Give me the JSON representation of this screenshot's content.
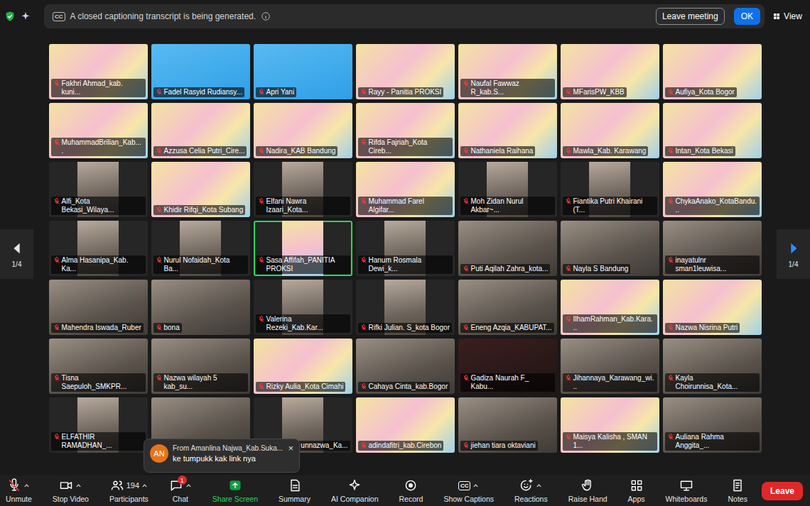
{
  "caption_banner": {
    "icon_text": "CC",
    "text": "A closed captioning transcript is being generated.",
    "buttons": [
      {
        "label": "Leave meeting",
        "primary": false
      },
      {
        "label": "OK",
        "primary": true
      }
    ]
  },
  "view": {
    "label": "View"
  },
  "pager": {
    "label": "1/4"
  },
  "gallery": {
    "tiles": [
      {
        "name": "Fakhri Ahmad_kab. kuni...",
        "kind": "banner",
        "muted": true,
        "speaking": false,
        "covered": false
      },
      {
        "name": "Fadel Rasyid Rudiansy...",
        "kind": "blue",
        "muted": true,
        "speaking": false,
        "covered": false
      },
      {
        "name": "Apri Yani",
        "kind": "blue",
        "muted": true,
        "speaking": false,
        "covered": false
      },
      {
        "name": "Rayy - Panitia PROKSI",
        "kind": "banner",
        "muted": true,
        "speaking": false,
        "covered": false
      },
      {
        "name": "Naufal Fawwaz R_kab.S...",
        "kind": "banner",
        "muted": true,
        "speaking": false,
        "covered": false
      },
      {
        "name": "MFarisPW_KBB",
        "kind": "banner",
        "muted": true,
        "speaking": false,
        "covered": false
      },
      {
        "name": "Aufiya_Kota Bogor",
        "kind": "banner",
        "muted": true,
        "speaking": false,
        "covered": false
      },
      {
        "name": "MuhammadBrilian_Kab....",
        "kind": "banner",
        "muted": true,
        "speaking": false,
        "covered": false
      },
      {
        "name": "Azzusa Celia Putri_Cire...",
        "kind": "banner",
        "muted": true,
        "speaking": false,
        "covered": false
      },
      {
        "name": "Nadira_KAB Bandung",
        "kind": "banner",
        "muted": true,
        "speaking": false,
        "covered": false
      },
      {
        "name": "Rifda Fajriah_Kota Cireb...",
        "kind": "banner",
        "muted": true,
        "speaking": false,
        "covered": false
      },
      {
        "name": "Nathaniela Raihana",
        "kind": "banner",
        "muted": true,
        "speaking": false,
        "covered": false
      },
      {
        "name": "Mawla_Kab. Karawang",
        "kind": "banner",
        "muted": true,
        "speaking": false,
        "covered": false
      },
      {
        "name": "Intan_Kota Bekasi",
        "kind": "banner",
        "muted": true,
        "speaking": false,
        "covered": false
      },
      {
        "name": "Alfi_Kota Bekasi_Wilaya...",
        "kind": "phone",
        "muted": true,
        "speaking": false,
        "covered": false
      },
      {
        "name": "Khidir Rifqi_Kota Subang",
        "kind": "banner",
        "muted": true,
        "speaking": false,
        "covered": false
      },
      {
        "name": "Elfani Nawra Izaari_Kota...",
        "kind": "phone",
        "muted": true,
        "speaking": false,
        "covered": false
      },
      {
        "name": "Muhammad Farel Algifar...",
        "kind": "banner",
        "muted": true,
        "speaking": false,
        "covered": false
      },
      {
        "name": "Moh Zidan Nurul Akbar~...",
        "kind": "phone",
        "muted": true,
        "speaking": false,
        "covered": false
      },
      {
        "name": "Fiantika Putri Khairani (T...",
        "kind": "phone",
        "muted": true,
        "speaking": false,
        "covered": false
      },
      {
        "name": "ChykaAnako_KotaBandu...",
        "kind": "banner",
        "muted": true,
        "speaking": false,
        "covered": false
      },
      {
        "name": "Alma Hasanipa_Kab. Ka...",
        "kind": "phone",
        "muted": true,
        "speaking": false,
        "covered": false
      },
      {
        "name": "Nurul Nofaidah_Kota Ba...",
        "kind": "phone",
        "muted": true,
        "speaking": false,
        "covered": false
      },
      {
        "name": "Sasa Affifah_PANITIA PROKSI",
        "kind": "phone",
        "muted": true,
        "speaking": true,
        "covered": false
      },
      {
        "name": "Hanum Rosmala Dewi_k...",
        "kind": "phone",
        "muted": true,
        "speaking": false,
        "covered": false
      },
      {
        "name": "Puti Aqilah Zahra_kota...",
        "kind": "camera",
        "muted": true,
        "speaking": false,
        "covered": false
      },
      {
        "name": "Nayla S Bandung",
        "kind": "camera",
        "muted": true,
        "speaking": false,
        "covered": false
      },
      {
        "name": "inayatulnr sman1leuwisa...",
        "kind": "camera",
        "muted": true,
        "speaking": false,
        "covered": false
      },
      {
        "name": "Mahendra Iswada_Ruber",
        "kind": "camera",
        "muted": true,
        "speaking": false,
        "covered": false
      },
      {
        "name": "bona",
        "kind": "camera",
        "muted": true,
        "speaking": false,
        "covered": false
      },
      {
        "name": "Valerina Rezeki_Kab.Kar...",
        "kind": "phone",
        "muted": true,
        "speaking": false,
        "covered": false
      },
      {
        "name": "Rifki Julian. S_kota Bogor",
        "kind": "phone",
        "muted": true,
        "speaking": false,
        "covered": false
      },
      {
        "name": "Eneng Azqia_KABUPAT...",
        "kind": "camera",
        "muted": true,
        "speaking": false,
        "covered": false
      },
      {
        "name": "IlhamRahman_Kab.Kara...",
        "kind": "banner",
        "muted": true,
        "speaking": false,
        "covered": false
      },
      {
        "name": "Nazwa Nisrina Putri",
        "kind": "banner",
        "muted": true,
        "speaking": false,
        "covered": false
      },
      {
        "name": "Tisna Saepuloh_SMKPR...",
        "kind": "camera",
        "muted": true,
        "speaking": false,
        "covered": false
      },
      {
        "name": "Nazwa wilayah 5 kab_su...",
        "kind": "camera",
        "muted": true,
        "speaking": false,
        "covered": false
      },
      {
        "name": "Rizky Aulia_Kota Cimahi",
        "kind": "banner",
        "muted": true,
        "speaking": false,
        "covered": false
      },
      {
        "name": "Cahaya Cinta_kab.Bogor",
        "kind": "camera",
        "muted": true,
        "speaking": false,
        "covered": false
      },
      {
        "name": "Gadiza Naurah F_ Kabu...",
        "kind": "dark",
        "muted": true,
        "speaking": false,
        "covered": false
      },
      {
        "name": "Jihannaya_Karawang_wi...",
        "kind": "camera",
        "muted": true,
        "speaking": false,
        "covered": false
      },
      {
        "name": "Kayla Choirunnisa_Kota...",
        "kind": "camera",
        "muted": true,
        "speaking": false,
        "covered": false
      },
      {
        "name": "ELFATHIR RAMADHAN_...",
        "kind": "phone",
        "muted": true,
        "speaking": false,
        "covered": false
      },
      {
        "kind": "camera",
        "muted": true,
        "speaking": false,
        "covered": true
      },
      {
        "name": "unnazwa_Ka...",
        "kind": "phone",
        "muted": true,
        "speaking": false,
        "covered": true
      },
      {
        "name": "adindafitri_kab.Cirebon",
        "kind": "banner",
        "muted": true,
        "speaking": false,
        "covered": false
      },
      {
        "name": "jiehan tiara oktaviani",
        "kind": "camera",
        "muted": true,
        "speaking": false,
        "covered": false
      },
      {
        "name": "Maisya Kalisha , SMAN 1...",
        "kind": "banner",
        "muted": true,
        "speaking": false,
        "covered": false
      },
      {
        "name": "Auliana Rahma Anggita_...",
        "kind": "camera",
        "muted": true,
        "speaking": false,
        "covered": false
      }
    ]
  },
  "chat_toast": {
    "avatar": "AN",
    "from": "From Amanlina Najwa_Kab.Suka...",
    "message": "ke tumpukk kak link nya",
    "close": "×"
  },
  "toolbar": {
    "items": [
      {
        "label": "Unmute",
        "menu": true,
        "off": true,
        "active": false
      },
      {
        "label": "Stop Video",
        "menu": true,
        "off": false,
        "active": false
      },
      {
        "label": "Participants",
        "menu": true,
        "off": false,
        "active": false,
        "count": "194"
      },
      {
        "label": "Chat",
        "menu": true,
        "off": false,
        "active": false,
        "badge": "1"
      },
      {
        "label": "Share Screen",
        "menu": false,
        "off": false,
        "active": true
      },
      {
        "label": "Summary",
        "menu": false,
        "off": false,
        "active": false
      },
      {
        "label": "AI Companion",
        "menu": false,
        "off": false,
        "active": false
      },
      {
        "label": "Record",
        "menu": false,
        "off": false,
        "active": false
      },
      {
        "label": "Show Captions",
        "menu": true,
        "off": false,
        "active": false,
        "icon_text": "CC"
      },
      {
        "label": "Reactions",
        "menu": true,
        "off": false,
        "active": false
      },
      {
        "label": "Raise Hand",
        "menu": false,
        "off": false,
        "active": false
      },
      {
        "label": "Apps",
        "menu": false,
        "off": false,
        "active": false
      },
      {
        "label": "Whiteboards",
        "menu": false,
        "off": false,
        "active": false
      },
      {
        "label": "Notes",
        "menu": false,
        "off": false,
        "active": false
      }
    ],
    "leave": {
      "label": "Leave"
    }
  }
}
